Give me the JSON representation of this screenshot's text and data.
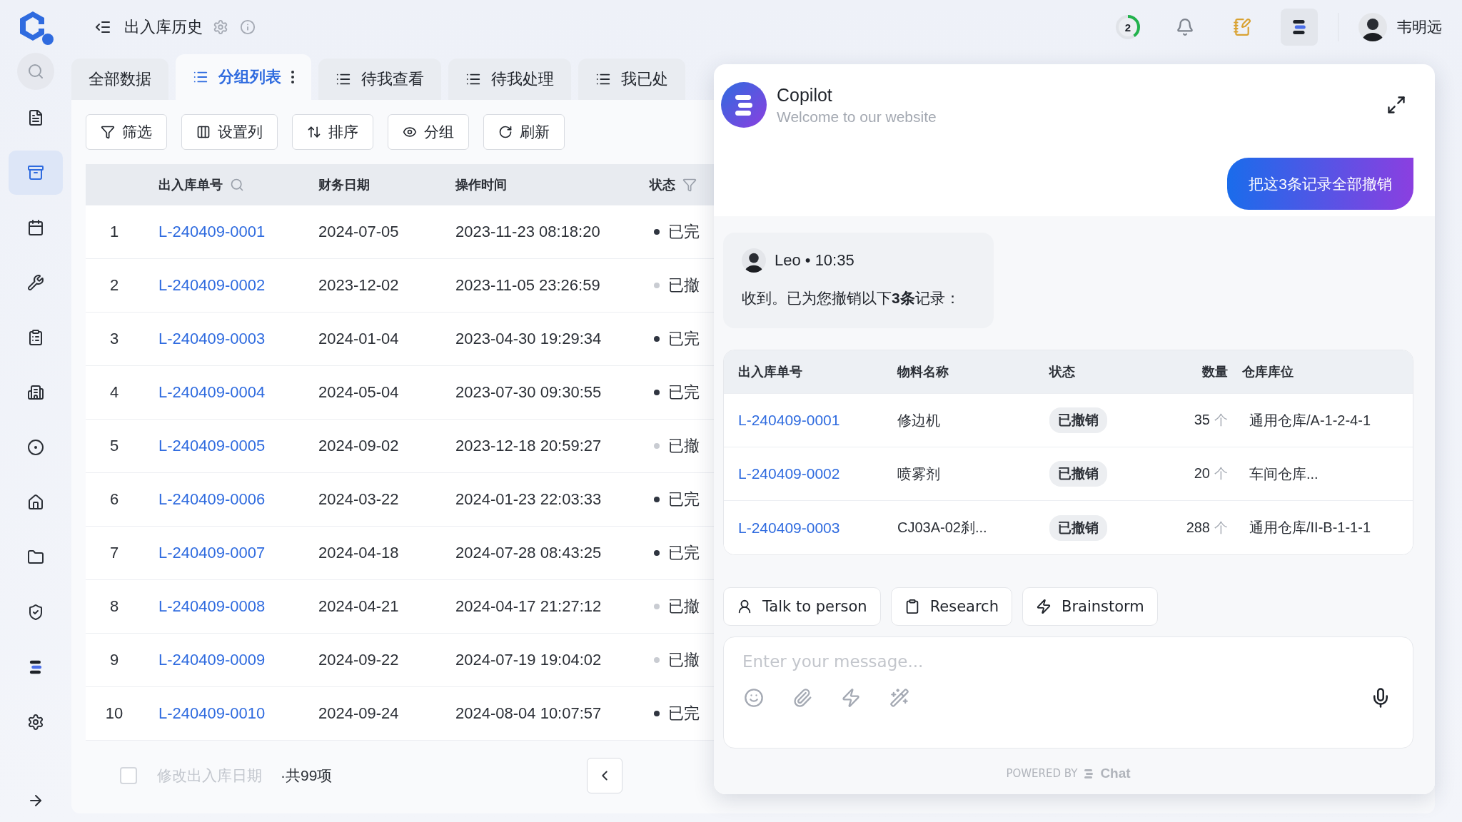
{
  "header": {
    "title": "出入库历史",
    "progress": {
      "count": "2",
      "level": 0.4
    },
    "copilot_toggle": {
      "selected": true
    },
    "user": {
      "name": "韦明远"
    }
  },
  "sidebar": {
    "items": [
      {
        "selected": false
      },
      {
        "selected": true
      },
      {
        "selected": false
      },
      {
        "selected": false
      },
      {
        "selected": false
      },
      {
        "selected": false
      },
      {
        "selected": false
      },
      {
        "selected": false
      },
      {
        "selected": false
      },
      {
        "selected": false
      },
      {
        "selected": false
      },
      {
        "selected": false
      }
    ]
  },
  "tabs": [
    {
      "label": "全部数据",
      "kind": "plain",
      "selected": false
    },
    {
      "label": "分组列表",
      "kind": "list",
      "selected": true
    },
    {
      "label": "待我查看",
      "kind": "list",
      "selected": false
    },
    {
      "label": "待我处理",
      "kind": "list",
      "selected": false
    },
    {
      "label": "我已处",
      "kind": "list",
      "selected": false
    }
  ],
  "toolbar": [
    "筛选",
    "设置列",
    "排序",
    "分组",
    "刷新"
  ],
  "table": {
    "columns": [
      "出入库单号",
      "财务日期",
      "操作时间",
      "状态"
    ],
    "rows": [
      {
        "index": "1",
        "id": "L-240409-0001",
        "date": "2024-07-05",
        "time": "2023-11-23 08:18:20",
        "status": "已完",
        "color": "#2f3540"
      },
      {
        "index": "2",
        "id": "L-240409-0002",
        "date": "2023-12-02",
        "time": "2023-11-05 23:26:59",
        "status": "已撤",
        "color": "#c9ccd2"
      },
      {
        "index": "3",
        "id": "L-240409-0003",
        "date": "2024-01-04",
        "time": "2023-04-30 19:29:34",
        "status": "已完",
        "color": "#2f3540"
      },
      {
        "index": "4",
        "id": "L-240409-0004",
        "date": "2024-05-04",
        "time": "2023-07-30 09:30:55",
        "status": "已完",
        "color": "#2f3540"
      },
      {
        "index": "5",
        "id": "L-240409-0005",
        "date": "2024-09-02",
        "time": "2023-12-18 20:59:27",
        "status": "已撤",
        "color": "#c9ccd2"
      },
      {
        "index": "6",
        "id": "L-240409-0006",
        "date": "2024-03-22",
        "time": "2024-01-23 22:03:33",
        "status": "已完",
        "color": "#2f3540"
      },
      {
        "index": "7",
        "id": "L-240409-0007",
        "date": "2024-04-18",
        "time": "2024-07-28 08:43:25",
        "status": "已完",
        "color": "#2f3540"
      },
      {
        "index": "8",
        "id": "L-240409-0008",
        "date": "2024-04-21",
        "time": "2024-04-17 21:27:12",
        "status": "已撤",
        "color": "#c9ccd2"
      },
      {
        "index": "9",
        "id": "L-240409-0009",
        "date": "2024-09-22",
        "time": "2024-07-19 19:04:02",
        "status": "已撤",
        "color": "#c9ccd2"
      },
      {
        "index": "10",
        "id": "L-240409-0010",
        "date": "2024-09-24",
        "time": "2024-08-04 10:07:57",
        "status": "已完",
        "color": "#2f3540"
      }
    ]
  },
  "footer": {
    "select_all": {
      "checked": false
    },
    "bulk_action": {
      "label": "修改出入库日期",
      "disabled": true
    },
    "total": "·共99项"
  },
  "copilot": {
    "title": "Copilot",
    "subtitle": "Welcome to our website",
    "messages": [
      {
        "kind": "user",
        "text": "把这3条记录全部撤销"
      },
      {
        "kind": "bot",
        "meta": "Leo • 10:35",
        "text": "收到。已为您撤销以下**3条**记录："
      }
    ],
    "result_table": {
      "columns": [
        "出入库单号",
        "物料名称",
        "状态",
        "数量",
        "仓库库位"
      ],
      "rows": [
        {
          "id": "L-240409-0001",
          "material": "修边机",
          "status": "已撤销",
          "quantity": "35",
          "unit": "个",
          "location": "通用仓库/A-1-2-4-1"
        },
        {
          "id": "L-240409-0002",
          "material": "喷雾剂",
          "status": "已撤销",
          "quantity": "20",
          "unit": "个",
          "location": "车间仓库..."
        },
        {
          "id": "L-240409-0003",
          "material": "CJ03A-02刹...",
          "status": "已撤销",
          "quantity": "288",
          "unit": "个",
          "location": "通用仓库/II-B-1-1-1"
        }
      ]
    },
    "chips": [
      "Talk to person",
      "Research",
      "Brainstorm"
    ],
    "input": {
      "placeholder": "Enter your message..."
    },
    "powered_by": {
      "label": "POWERED BY",
      "brand": "Chat"
    }
  }
}
